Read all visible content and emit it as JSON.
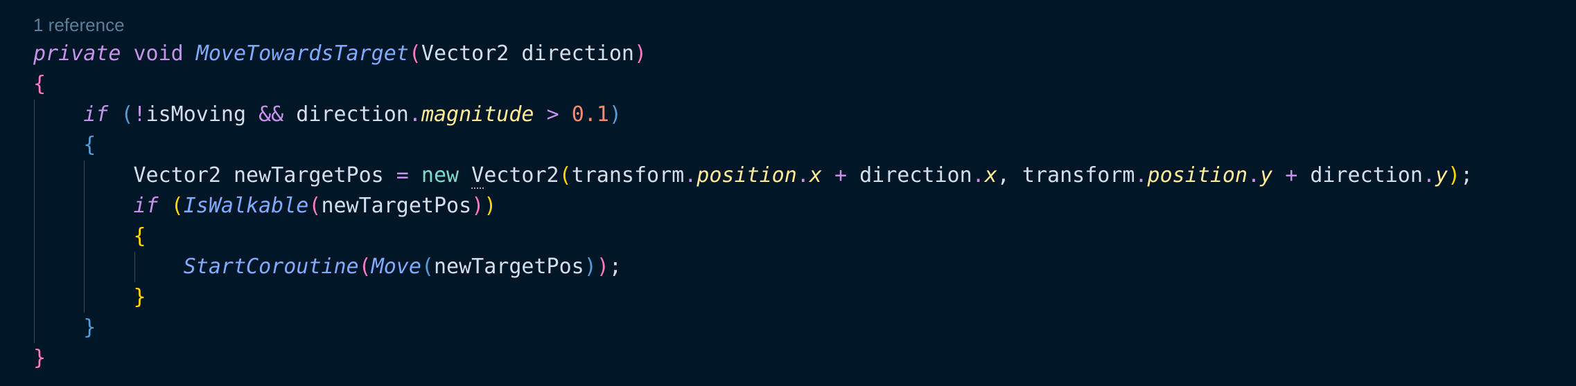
{
  "editor": {
    "codelens": "1 reference",
    "colors": {
      "background": "#011627",
      "default_text": "#d6deeb",
      "keyword": "#c792ea",
      "function": "#82aaff",
      "property": "#ffeb95",
      "number": "#f78c6c",
      "new_keyword": "#7fdbca",
      "bracket_level_1": "#ff79c6",
      "bracket_level_2": "#569cd6",
      "bracket_level_3": "#ffd700",
      "codelens": "#5f7e97",
      "indent_guide": "#3b4a5c"
    },
    "lines": [
      {
        "indent": 0,
        "tokens": [
          {
            "t": "private",
            "c": "kw-i"
          },
          {
            "t": " ",
            "c": "pun"
          },
          {
            "t": "void",
            "c": "kw"
          },
          {
            "t": " ",
            "c": "pun"
          },
          {
            "t": "MoveTowardsTarget",
            "c": "fn"
          },
          {
            "t": "(",
            "c": "b1"
          },
          {
            "t": "Vector2 direction",
            "c": "pun"
          },
          {
            "t": ")",
            "c": "b1"
          }
        ]
      },
      {
        "indent": 0,
        "tokens": [
          {
            "t": "{",
            "c": "b1"
          }
        ]
      },
      {
        "indent": 1,
        "tokens": [
          {
            "t": "if",
            "c": "kw-i"
          },
          {
            "t": " ",
            "c": "pun"
          },
          {
            "t": "(",
            "c": "b2"
          },
          {
            "t": "!",
            "c": "op"
          },
          {
            "t": "isMoving ",
            "c": "pun"
          },
          {
            "t": "&&",
            "c": "op"
          },
          {
            "t": " direction",
            "c": "pun"
          },
          {
            "t": ".",
            "c": "op"
          },
          {
            "t": "magnitude",
            "c": "prop"
          },
          {
            "t": " ",
            "c": "pun"
          },
          {
            "t": ">",
            "c": "op"
          },
          {
            "t": " ",
            "c": "pun"
          },
          {
            "t": "0.1",
            "c": "num"
          },
          {
            "t": ")",
            "c": "b2"
          }
        ]
      },
      {
        "indent": 1,
        "tokens": [
          {
            "t": "{",
            "c": "b2"
          }
        ]
      },
      {
        "indent": 2,
        "tokens": [
          {
            "t": "Vector2 newTargetPos ",
            "c": "pun"
          },
          {
            "t": "=",
            "c": "op"
          },
          {
            "t": " ",
            "c": "pun"
          },
          {
            "t": "new",
            "c": "new"
          },
          {
            "t": " ",
            "c": "pun"
          },
          {
            "t": "V",
            "c": "pun squiggle"
          },
          {
            "t": "ector2",
            "c": "pun"
          },
          {
            "t": "(",
            "c": "b3"
          },
          {
            "t": "transform",
            "c": "pun"
          },
          {
            "t": ".",
            "c": "op"
          },
          {
            "t": "position",
            "c": "prop"
          },
          {
            "t": ".",
            "c": "op"
          },
          {
            "t": "x",
            "c": "prop"
          },
          {
            "t": " ",
            "c": "pun"
          },
          {
            "t": "+",
            "c": "op"
          },
          {
            "t": " direction",
            "c": "pun"
          },
          {
            "t": ".",
            "c": "op"
          },
          {
            "t": "x",
            "c": "prop"
          },
          {
            "t": ", transform",
            "c": "pun"
          },
          {
            "t": ".",
            "c": "op"
          },
          {
            "t": "position",
            "c": "prop"
          },
          {
            "t": ".",
            "c": "op"
          },
          {
            "t": "y",
            "c": "prop"
          },
          {
            "t": " ",
            "c": "pun"
          },
          {
            "t": "+",
            "c": "op"
          },
          {
            "t": " direction",
            "c": "pun"
          },
          {
            "t": ".",
            "c": "op"
          },
          {
            "t": "y",
            "c": "prop"
          },
          {
            "t": ")",
            "c": "b3"
          },
          {
            "t": ";",
            "c": "pun"
          }
        ]
      },
      {
        "indent": 2,
        "tokens": [
          {
            "t": "if",
            "c": "kw-i"
          },
          {
            "t": " ",
            "c": "pun"
          },
          {
            "t": "(",
            "c": "b3"
          },
          {
            "t": "IsWalkable",
            "c": "fn"
          },
          {
            "t": "(",
            "c": "b1"
          },
          {
            "t": "newTargetPos",
            "c": "pun"
          },
          {
            "t": ")",
            "c": "b1"
          },
          {
            "t": ")",
            "c": "b3"
          }
        ]
      },
      {
        "indent": 2,
        "tokens": [
          {
            "t": "{",
            "c": "b3"
          }
        ]
      },
      {
        "indent": 3,
        "tokens": [
          {
            "t": "StartCoroutine",
            "c": "fn"
          },
          {
            "t": "(",
            "c": "b1"
          },
          {
            "t": "Move",
            "c": "fn"
          },
          {
            "t": "(",
            "c": "b2"
          },
          {
            "t": "newTargetPos",
            "c": "pun"
          },
          {
            "t": ")",
            "c": "b2"
          },
          {
            "t": ")",
            "c": "b1"
          },
          {
            "t": ";",
            "c": "pun"
          }
        ]
      },
      {
        "indent": 2,
        "tokens": [
          {
            "t": "}",
            "c": "b3"
          }
        ]
      },
      {
        "indent": 1,
        "tokens": [
          {
            "t": "}",
            "c": "b2"
          }
        ]
      },
      {
        "indent": 0,
        "tokens": [
          {
            "t": "}",
            "c": "b1"
          }
        ]
      }
    ]
  }
}
